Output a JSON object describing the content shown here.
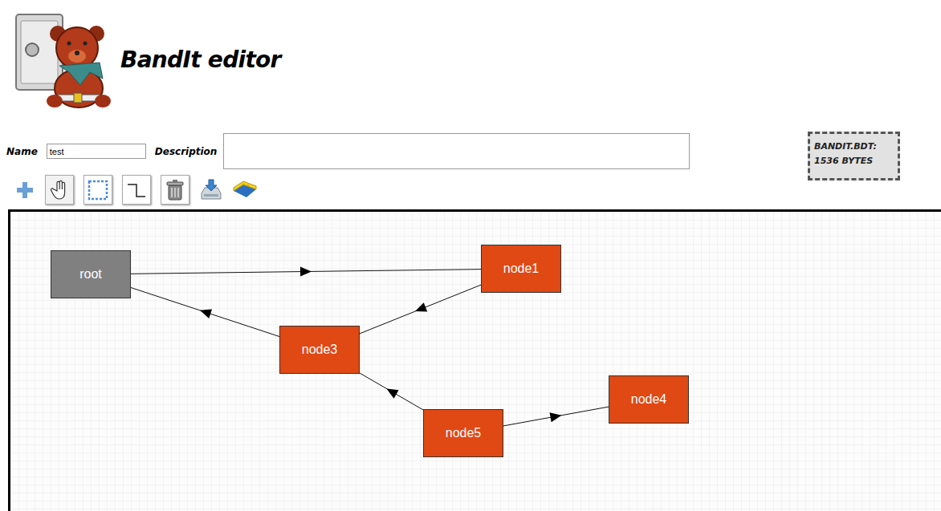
{
  "app": {
    "title": "BandIt editor"
  },
  "form": {
    "name_label": "Name",
    "name_value": "test",
    "description_label": "Description",
    "description_value": ""
  },
  "file_info": {
    "lines": [
      "BANDIT.BDT:",
      "1536 BYTES"
    ]
  },
  "toolbar": [
    {
      "kind": "button",
      "selected": false
    },
    {
      "kind": "toggle",
      "selected": true
    },
    {
      "kind": "toggle",
      "selected": false
    },
    {
      "kind": "toggle",
      "selected": false
    },
    {
      "kind": "toggle",
      "selected": false
    },
    {
      "kind": "button",
      "selected": false
    },
    {
      "kind": "button",
      "selected": false
    }
  ],
  "diagram": {
    "nodes": [
      {
        "label": "root",
        "color": "#808080"
      },
      {
        "label": "node1",
        "color": "#e04814"
      },
      {
        "label": "node3",
        "color": "#e04814"
      },
      {
        "label": "node5",
        "color": "#e04814"
      },
      {
        "label": "node4",
        "color": "#e04814"
      }
    ],
    "edges": [
      {
        "from": 0,
        "to": 1
      },
      {
        "from": 1,
        "to": 2
      },
      {
        "from": 2,
        "to": 0
      },
      {
        "from": 3,
        "to": 2
      },
      {
        "from": 3,
        "to": 4
      }
    ]
  }
}
